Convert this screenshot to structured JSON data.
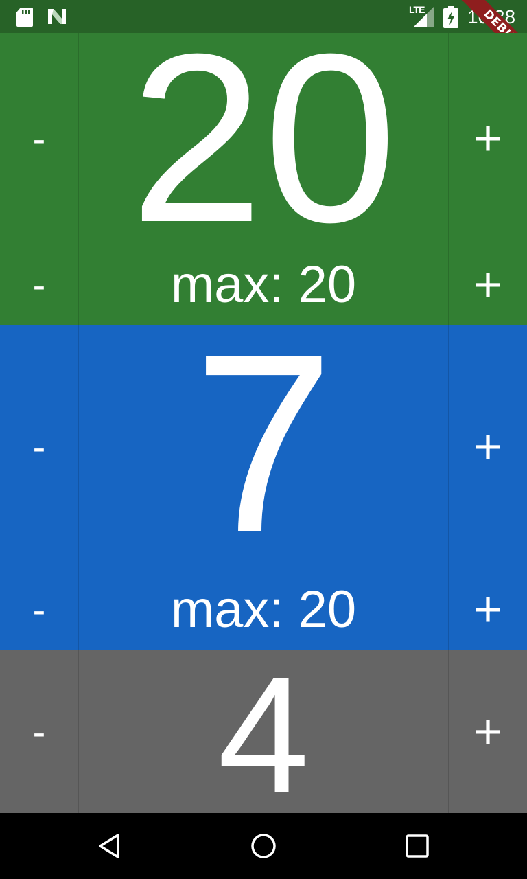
{
  "status_bar": {
    "network_type": "LTE",
    "time": "10:28",
    "debug_label": "DEBUG"
  },
  "counters": [
    {
      "value": "20",
      "max_label": "max: 20",
      "color": "#327f33",
      "decrement_label": "-",
      "increment_label": "+"
    },
    {
      "value": "7",
      "max_label": "max: 20",
      "color": "#1765c2",
      "decrement_label": "-",
      "increment_label": "+"
    },
    {
      "value": "4",
      "color": "#656565",
      "decrement_label": "-",
      "increment_label": "+"
    }
  ],
  "nav_bar": {
    "icons": [
      "back-icon",
      "home-icon",
      "recent-apps-icon"
    ]
  }
}
